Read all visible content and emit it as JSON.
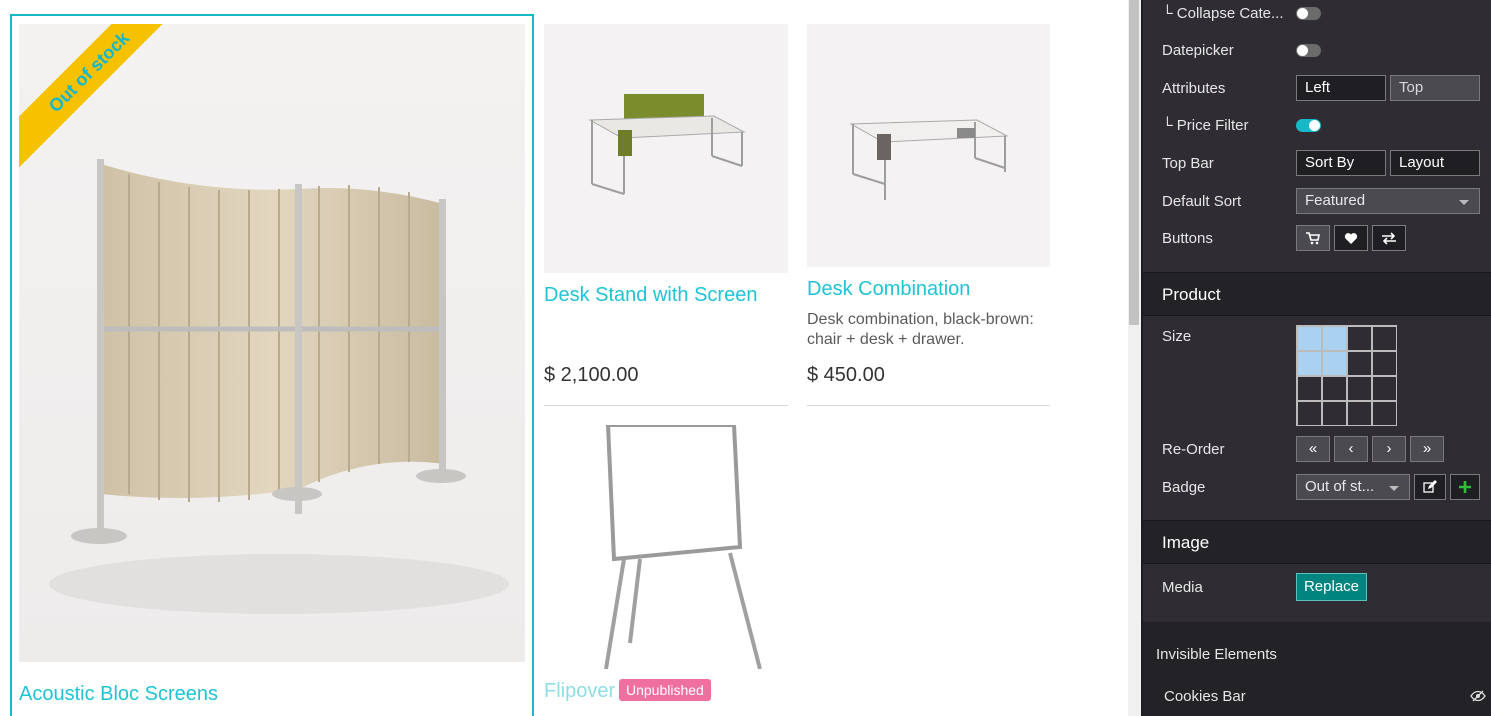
{
  "products": {
    "acoustic": {
      "title": "Acoustic Bloc Screens",
      "ribbon": "Out of stock"
    },
    "desk_stand": {
      "title": "Desk Stand with Screen",
      "price": "$ 2,100.00"
    },
    "desk_combination": {
      "title": "Desk Combination",
      "description": "Desk combination, black-brown: chair + desk + drawer.",
      "price": "$ 450.00"
    },
    "flipover": {
      "title": "Flipover",
      "badge": "Unpublished"
    }
  },
  "panel": {
    "collapse_categories": {
      "label": "└ Collapse Cate...",
      "on": false
    },
    "datepicker": {
      "label": "Datepicker",
      "on": false
    },
    "attributes": {
      "label": "Attributes",
      "options": [
        "Left",
        "Top"
      ]
    },
    "price_filter": {
      "label": "└ Price Filter",
      "on": true
    },
    "top_bar": {
      "label": "Top Bar",
      "options": [
        "Sort By",
        "Layout"
      ]
    },
    "default_sort": {
      "label": "Default Sort",
      "value": "Featured"
    },
    "buttons": {
      "label": "Buttons",
      "icons": [
        "cart-icon",
        "heart-icon",
        "compare-icon"
      ]
    },
    "product_section": {
      "title": "Product"
    },
    "size": {
      "label": "Size",
      "selected_cols": 2,
      "selected_rows": 2,
      "grid_cols": 4,
      "grid_rows": 4
    },
    "reorder": {
      "label": "Re-Order",
      "icons": [
        "«",
        "‹",
        "›",
        "»"
      ]
    },
    "badge": {
      "label": "Badge",
      "value": "Out of st..."
    },
    "image_section": {
      "title": "Image"
    },
    "media": {
      "label": "Media",
      "button": "Replace"
    },
    "invisible": {
      "title": "Invisible Elements",
      "items": [
        "Cookies Bar"
      ]
    }
  }
}
